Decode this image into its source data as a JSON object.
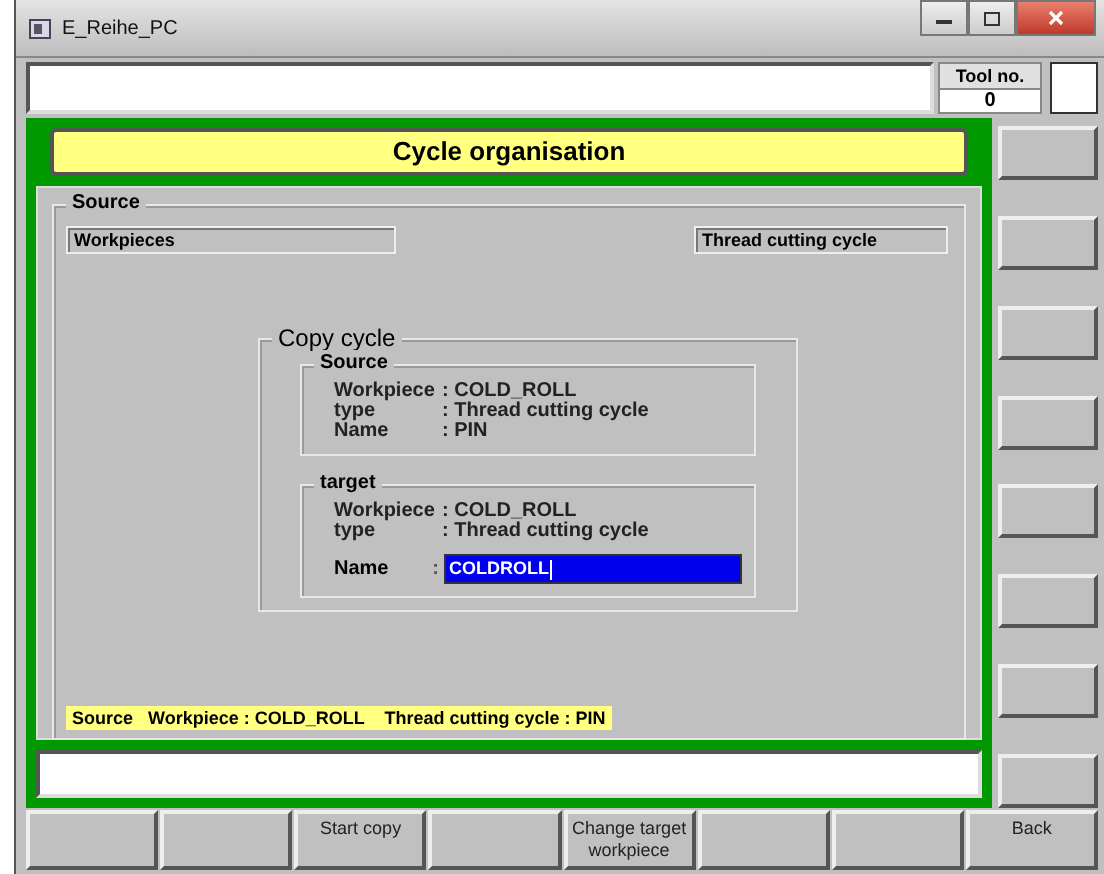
{
  "window": {
    "title": "E_Reihe_PC"
  },
  "tool": {
    "label": "Tool no.",
    "value": "0"
  },
  "header": "Cycle organisation",
  "source": {
    "legend": "Source",
    "left_field": "Workpieces",
    "right_field": "Thread cutting cycle"
  },
  "copy_cycle": {
    "legend": "Copy cycle",
    "source": {
      "legend": "Source",
      "rows": [
        {
          "label": "Workpiece",
          "value": ": COLD_ROLL"
        },
        {
          "label": "type",
          "value": ": Thread cutting cycle"
        },
        {
          "label": "Name",
          "value": ": PIN"
        }
      ]
    },
    "target": {
      "legend": "target",
      "rows": [
        {
          "label": "Workpiece",
          "value": ": COLD_ROLL"
        },
        {
          "label": "type",
          "value": ": Thread cutting cycle"
        }
      ],
      "name": {
        "label": "Name",
        "colon": ":",
        "value": "COLDROLL",
        "text_selected": true
      }
    }
  },
  "status_line": "Source   Workpiece : COLD_ROLL    Thread cutting cycle : PIN",
  "softkeys": {
    "key_3": "Start copy",
    "key_5": "Change target workpiece",
    "key_8": "Back"
  }
}
